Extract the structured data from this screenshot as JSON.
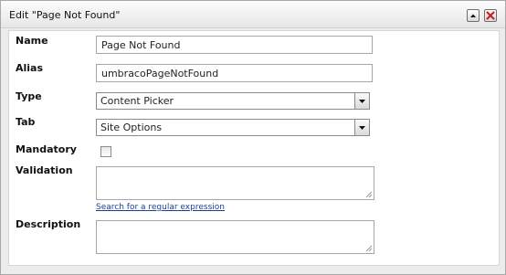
{
  "window": {
    "title": "Edit \"Page Not Found\"",
    "collapse_icon": "chevron-up-icon",
    "close_icon": "close-icon"
  },
  "form": {
    "name": {
      "label": "Name",
      "value": "Page Not Found"
    },
    "alias": {
      "label": "Alias",
      "value": "umbracoPageNotFound"
    },
    "type": {
      "label": "Type",
      "selected": "Content Picker"
    },
    "tab": {
      "label": "Tab",
      "selected": "Site Options"
    },
    "mandatory": {
      "label": "Mandatory",
      "checked": false
    },
    "validation": {
      "label": "Validation",
      "value": "",
      "link": "Search for a regular expression"
    },
    "description": {
      "label": "Description",
      "value": ""
    }
  },
  "colors": {
    "close_red": "#d21f1f",
    "link_blue": "#1a3f9a"
  }
}
